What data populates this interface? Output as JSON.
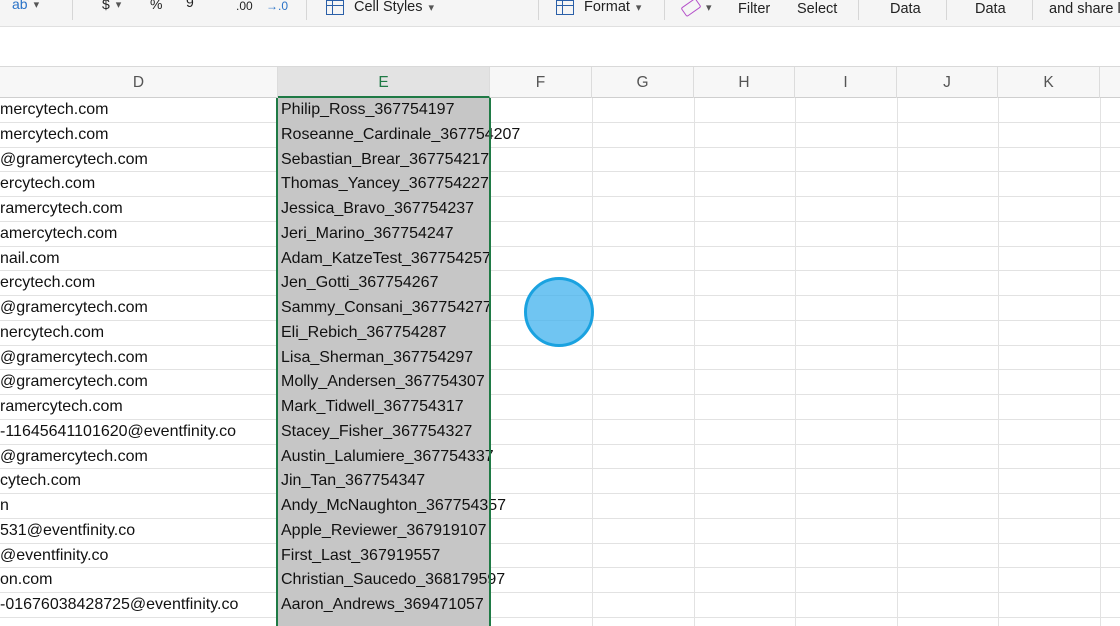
{
  "ribbon": {
    "wrap_text_fragment": "ab",
    "currency_symbol": "$",
    "percent_symbol": "%",
    "comma_symbol": "9",
    "increase_decimal": ".00",
    "decrease_decimal": "→.0",
    "cell_styles_label": "Cell Styles",
    "format_label": "Format",
    "filter_label": "Filter",
    "select_label": "Select",
    "data_label_1": "Data",
    "data_label_2": "Data",
    "share_label": "and share l"
  },
  "columns": [
    "D",
    "E",
    "F",
    "G",
    "H",
    "I",
    "J",
    "K"
  ],
  "selected_column": "E",
  "rows": [
    {
      "d": "mercytech.com",
      "e": "Philip_Ross_367754197"
    },
    {
      "d": "mercytech.com",
      "e": "Roseanne_Cardinale_367754207"
    },
    {
      "d": "@gramercytech.com",
      "e": "Sebastian_Brear_367754217"
    },
    {
      "d": "ercytech.com",
      "e": "Thomas_Yancey_367754227"
    },
    {
      "d": "ramercytech.com",
      "e": "Jessica_Bravo_367754237"
    },
    {
      "d": "amercytech.com",
      "e": "Jeri_Marino_367754247"
    },
    {
      "d": "nail.com",
      "e": "Adam_KatzeTest_367754257"
    },
    {
      "d": "ercytech.com",
      "e": "Jen_Gotti_367754267"
    },
    {
      "d": "@gramercytech.com",
      "e": "Sammy_Consani_367754277"
    },
    {
      "d": "nercytech.com",
      "e": "Eli_Rebich_367754287"
    },
    {
      "d": "@gramercytech.com",
      "e": "Lisa_Sherman_367754297"
    },
    {
      "d": "@gramercytech.com",
      "e": "Molly_Andersen_367754307"
    },
    {
      "d": "ramercytech.com",
      "e": "Mark_Tidwell_367754317"
    },
    {
      "d": "-11645641101620@eventfinity.co",
      "e": "Stacey_Fisher_367754327"
    },
    {
      "d": "@gramercytech.com",
      "e": "Austin_Lalumiere_367754337"
    },
    {
      "d": "cytech.com",
      "e": "Jin_Tan_367754347"
    },
    {
      "d": "n",
      "e": "Andy_McNaughton_367754357"
    },
    {
      "d": "531@eventfinity.co",
      "e": "Apple_Reviewer_367919107"
    },
    {
      "d": "@eventfinity.co",
      "e": "First_Last_367919557"
    },
    {
      "d": "on.com",
      "e": "Christian_Saucedo_368179597"
    },
    {
      "d": "-01676038428725@eventfinity.co",
      "e": "Aaron_Andrews_369471057"
    },
    {
      "d": "",
      "e": ""
    }
  ]
}
